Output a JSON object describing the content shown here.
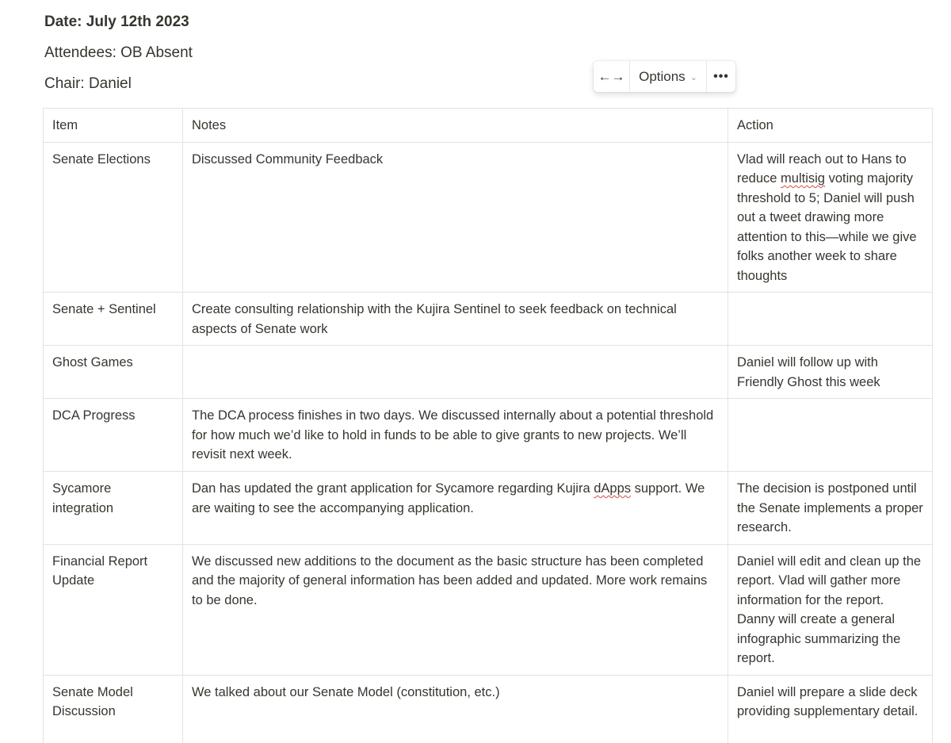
{
  "header": {
    "date": "Date: July 12th 2023",
    "attendees": "Attendees: OB Absent",
    "chair": "Chair: Daniel"
  },
  "toolbar": {
    "width_icon": "width-toggle-icon",
    "width_glyph": "←→",
    "options_label": "Options",
    "options_chevron": "⌄",
    "more_glyph": "•••"
  },
  "table": {
    "headers": [
      "Item",
      "Notes",
      "Action"
    ],
    "rows": [
      {
        "item": "Senate Elections",
        "notes": "Discussed Community Feedback",
        "action_pre": "Vlad will reach out to Hans to reduce ",
        "action_sq": "multisig",
        "action_post": " voting majority threshold to 5; Daniel will push out a tweet drawing more attention to this—while we give folks another week to share thoughts"
      },
      {
        "item": "Senate + Sentinel",
        "notes": "Create consulting relationship with the Kujira Sentinel to seek feedback on technical aspects of Senate work",
        "action": ""
      },
      {
        "item": "Ghost Games",
        "notes": "",
        "action": "Daniel will follow up with Friendly Ghost this week"
      },
      {
        "item": "DCA Progress",
        "notes": "The DCA process finishes in two days. We discussed internally about a potential threshold for how much we’d like to hold in funds to be able to give grants to new projects. We’ll revisit next week.",
        "action": ""
      },
      {
        "item": "Sycamore integration",
        "notes_pre": "Dan has updated the grant application for Sycamore regarding Kujira ",
        "notes_sq": "dApps",
        "notes_post": " support. We are waiting to see the accompanying application.",
        "action": "The decision is postponed until the Senate implements a proper research."
      },
      {
        "item": "Financial Report Update",
        "notes": "We discussed new additions to the document as the basic structure has been completed and the majority of general information has been added and updated. More work remains to be done.",
        "action": "Daniel will edit and clean up the report. Vlad will gather more information for the report. Danny will create a general infographic summarizing the report."
      },
      {
        "item": "Senate Model Discussion",
        "notes": "We talked about our Senate Model (constitution, etc.)",
        "action": "Daniel will prepare a slide deck providing supplementary detail."
      }
    ]
  },
  "colors": {
    "text": "#37352f",
    "border": "#e3e2e0",
    "spellcheck": "#d44c47"
  }
}
